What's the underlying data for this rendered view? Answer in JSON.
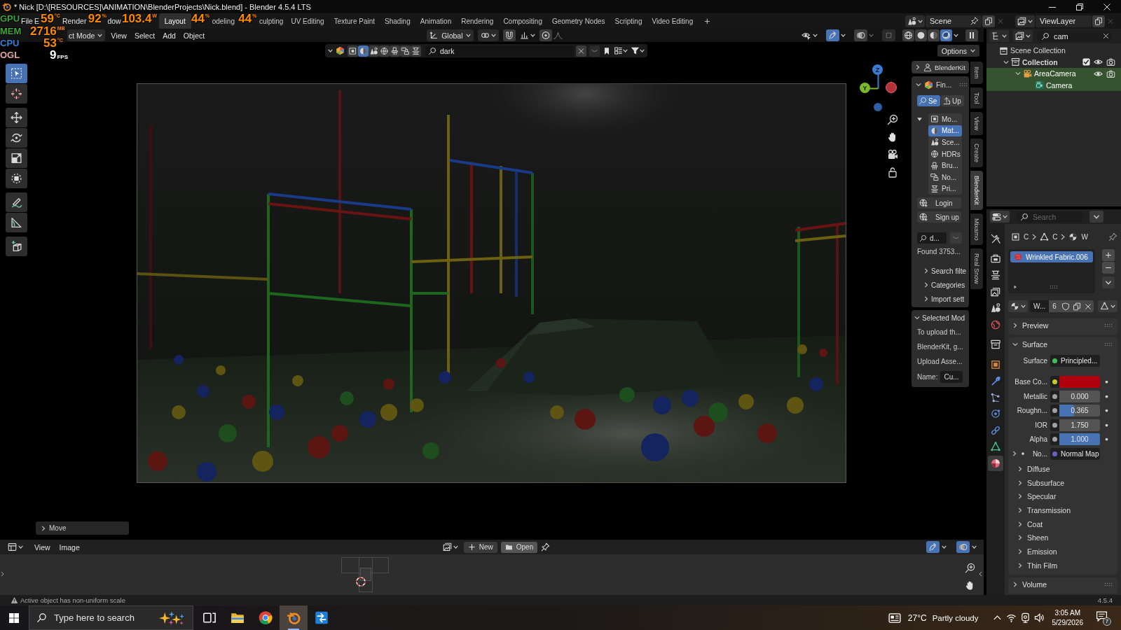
{
  "window": {
    "title": "* Nick [D:\\[RESOURCES]\\ANIMATION\\BlenderProjects\\Nick.blend] - Blender 4.5.4 LTS"
  },
  "menus": [
    "File",
    "E",
    "Render",
    "dow"
  ],
  "workspaces": [
    {
      "label": "Layout",
      "selected": true
    },
    {
      "label": "odeling",
      "selected": false
    },
    {
      "label": "culpting",
      "selected": false
    },
    {
      "label": "UV Editing",
      "selected": false
    },
    {
      "label": "Texture Paint",
      "selected": false
    },
    {
      "label": "Shading",
      "selected": false
    },
    {
      "label": "Animation",
      "selected": false
    },
    {
      "label": "Rendering",
      "selected": false
    },
    {
      "label": "Compositing",
      "selected": false
    },
    {
      "label": "Geometry Nodes",
      "selected": false
    },
    {
      "label": "Scripting",
      "selected": false
    },
    {
      "label": "Video Editing",
      "selected": false
    }
  ],
  "add_workspace": "+",
  "scene": {
    "name": "Scene"
  },
  "view_layer": {
    "name": "ViewLayer"
  },
  "performance_overlay": [
    {
      "label": "GPU",
      "color": "#3aa83a",
      "readings": [
        {
          "kind": "sensor",
          "value": "59",
          "unit": "°C"
        },
        {
          "kind": "sensor",
          "value": "92",
          "unit": "%"
        },
        {
          "kind": "sensor",
          "value": "103.4",
          "unit": "W"
        },
        {
          "kind": "sensor",
          "value": "44",
          "unit": "%"
        },
        {
          "kind": "sensor",
          "value": "44",
          "unit": "%"
        }
      ]
    },
    {
      "label": "MEM",
      "color": "#3aa83a",
      "readings": [
        {
          "kind": "sensor",
          "value": "2716",
          "unit": "MB"
        }
      ]
    },
    {
      "label": "CPU",
      "color": "#3b7fd4",
      "readings": [
        {
          "kind": "sensor",
          "value": "53",
          "unit": "°C"
        }
      ]
    },
    {
      "label": "OGL",
      "color": "#e3a3a3",
      "readings": [
        {
          "kind": "frame_rate",
          "value": "9",
          "unit": "FPS"
        }
      ]
    }
  ],
  "viewport": {
    "mode": "ct Mode",
    "menus": [
      "View",
      "Select",
      "Add",
      "Object"
    ],
    "orientation": "Global",
    "toggles": {
      "gizmos": true,
      "overlays": false,
      "xray": false
    },
    "shading": [
      {
        "kind": "wireframe",
        "selected": false
      },
      {
        "kind": "solid",
        "selected": false
      },
      {
        "kind": "material",
        "selected": false
      },
      {
        "kind": "rendered",
        "selected": true
      }
    ],
    "asset_bar": {
      "types": [
        {
          "kind": "model",
          "selected": false
        },
        {
          "kind": "material",
          "selected": true
        },
        {
          "kind": "scene",
          "selected": false
        },
        {
          "kind": "hdr",
          "selected": false
        },
        {
          "kind": "brush",
          "selected": false
        },
        {
          "kind": "nodegroup",
          "selected": false
        },
        {
          "kind": "printable",
          "selected": false
        }
      ],
      "search": "dark"
    },
    "options": "Options",
    "toolbar": [
      [
        {
          "kind": "select_box",
          "selected": true
        },
        {
          "kind": "cursor",
          "selected": false
        }
      ],
      [
        {
          "kind": "move",
          "selected": false
        },
        {
          "kind": "rotate",
          "selected": false
        },
        {
          "kind": "scale",
          "selected": false
        },
        {
          "kind": "transform",
          "selected": false
        }
      ],
      [
        {
          "kind": "annotate",
          "selected": false
        },
        {
          "kind": "measure",
          "selected": false
        }
      ],
      [
        {
          "kind": "add_cube",
          "selected": false
        }
      ]
    ],
    "gizmo_axes": [
      {
        "kind": "z",
        "label": "Z"
      },
      {
        "kind": "y",
        "label": "Y"
      },
      {
        "kind": "x"
      },
      {
        "kind": "neg_z"
      }
    ],
    "last_operation": {
      "label": "Move",
      "expanded": false
    },
    "sidebar": {
      "account": {
        "label": "BlenderKit",
        "expanded": false
      },
      "find": {
        "label": "Fin...",
        "expanded": true,
        "modes": [
          {
            "kind": "search",
            "label": "Se",
            "selected": true
          },
          {
            "kind": "upload",
            "label": "Up",
            "selected": false
          }
        ],
        "types_expanded": true,
        "asset_types": [
          {
            "kind": "model",
            "label": "Mo...",
            "selected": false
          },
          {
            "kind": "material",
            "label": "Mat...",
            "selected": true
          },
          {
            "kind": "scene",
            "label": "Sce...",
            "selected": false
          },
          {
            "kind": "hdr",
            "label": "HDRs",
            "selected": false
          },
          {
            "kind": "brush",
            "label": "Bru...",
            "selected": false
          },
          {
            "kind": "nodegroup",
            "label": "No...",
            "selected": false
          },
          {
            "kind": "printable",
            "label": "Pri...",
            "selected": false
          }
        ],
        "account_buttons": [
          "Login",
          "Sign up"
        ],
        "search": "d...",
        "found": "Found 3753...",
        "subpanels": [
          {
            "label": "Search filte",
            "expanded": false
          },
          {
            "label": "Categories",
            "expanded": false
          },
          {
            "label": "Import sett",
            "expanded": false
          }
        ]
      },
      "selected_model": {
        "label": "Selected Mod",
        "expanded": true,
        "lines": [
          "To upload th...",
          "BlenderKit, g...",
          "Upload Asse..."
        ],
        "name_label": "Name:",
        "name_value": "Cu..."
      }
    },
    "sidebar_tabs": [
      {
        "label": "Item",
        "selected": false
      },
      {
        "label": "Tool",
        "selected": false
      },
      {
        "label": "View",
        "selected": false
      },
      {
        "label": "Create",
        "selected": false
      },
      {
        "label": "BlenderKit",
        "selected": true
      },
      {
        "label": "Mixamo",
        "selected": false
      },
      {
        "label": "Real Snow",
        "selected": false
      }
    ]
  },
  "image_editor": {
    "menus": [
      "View",
      "Image"
    ],
    "buttons": [
      {
        "kind": "new",
        "label": "New"
      },
      {
        "kind": "open",
        "label": "Open"
      }
    ]
  },
  "outliner": {
    "search": "cam",
    "tree": [
      {
        "label": "Scene Collection",
        "kind": "scene_collection",
        "selected": false,
        "children": [
          {
            "label": "Collection",
            "kind": "collection",
            "expanded": true,
            "checked": true,
            "visible": true,
            "renderable": true,
            "selected": false,
            "children": [
              {
                "label": "AreaCamera",
                "kind": "camera_object",
                "expanded": true,
                "visible": true,
                "renderable": true,
                "selected": true,
                "children": [
                  {
                    "label": "Camera",
                    "kind": "camera_data",
                    "selected": true
                  }
                ]
              }
            ]
          }
        ]
      }
    ]
  },
  "properties": {
    "search_placeholder": "Search",
    "tabs": [
      {
        "kind": "tool",
        "selected": false
      },
      {
        "kind": "render",
        "selected": false
      },
      {
        "kind": "output",
        "selected": false
      },
      {
        "kind": "view_layer",
        "selected": false
      },
      {
        "kind": "scene",
        "selected": false
      },
      {
        "kind": "world",
        "selected": false
      },
      {
        "kind": "collection",
        "selected": false
      },
      {
        "kind": "object",
        "selected": false
      },
      {
        "kind": "modifiers",
        "selected": false
      },
      {
        "kind": "particles",
        "selected": false
      },
      {
        "kind": "physics",
        "selected": false
      },
      {
        "kind": "constraints",
        "selected": false
      },
      {
        "kind": "data",
        "selected": false
      },
      {
        "kind": "material",
        "selected": true
      }
    ],
    "breadcrumb": [
      {
        "kind": "object",
        "label": "C"
      },
      {
        "kind": "data",
        "label": "C"
      },
      {
        "kind": "material",
        "label": "W"
      }
    ],
    "slots": [
      {
        "name": "Wrinkled Fabric.006",
        "selected": true
      }
    ],
    "material": {
      "name": "W...",
      "users": "6"
    },
    "panels": [
      {
        "label": "Preview",
        "expanded": false
      },
      {
        "label": "Surface",
        "expanded": true,
        "rows": [
          {
            "kind": "shader",
            "label": "Surface",
            "value": "Principled..."
          },
          {
            "kind": "color",
            "label": "Base Co...",
            "color": "#b0000f"
          },
          {
            "kind": "number",
            "label": "Metallic",
            "value": "0.000"
          },
          {
            "kind": "slider",
            "label": "Roughn...",
            "value": "0.365",
            "level": 0.365
          },
          {
            "kind": "number",
            "label": "IOR",
            "value": "1.750"
          },
          {
            "kind": "slider",
            "label": "Alpha",
            "value": "1.000",
            "level": 1
          },
          {
            "kind": "link",
            "label": "No...",
            "value": "Normal Map",
            "expanded": false
          }
        ],
        "subpanels": [
          {
            "label": "Diffuse",
            "expanded": false
          },
          {
            "label": "Subsurface",
            "expanded": false
          },
          {
            "label": "Specular",
            "expanded": false
          },
          {
            "label": "Transmission",
            "expanded": false
          },
          {
            "label": "Coat",
            "expanded": false
          },
          {
            "label": "Sheen",
            "expanded": false
          },
          {
            "label": "Emission",
            "expanded": false
          },
          {
            "label": "Thin Film",
            "expanded": false
          }
        ]
      },
      {
        "label": "Volume",
        "expanded": false
      }
    ]
  },
  "status_bar": {
    "message": "Active object has non-uniform scale",
    "version": "4.5.4"
  },
  "taskbar": {
    "search_placeholder": "Type here to search",
    "apps": [
      {
        "kind": "task_view",
        "selected": false
      },
      {
        "kind": "folder",
        "selected": false
      },
      {
        "kind": "browser",
        "selected": false
      },
      {
        "kind": "blender",
        "selected": true
      },
      {
        "kind": "arrow_app",
        "selected": false
      }
    ],
    "weather": {
      "temperature": "27°C",
      "condition": "Partly cloudy"
    },
    "time": "3:05 AM",
    "date": "5/29/2026",
    "notification_count": "7"
  }
}
